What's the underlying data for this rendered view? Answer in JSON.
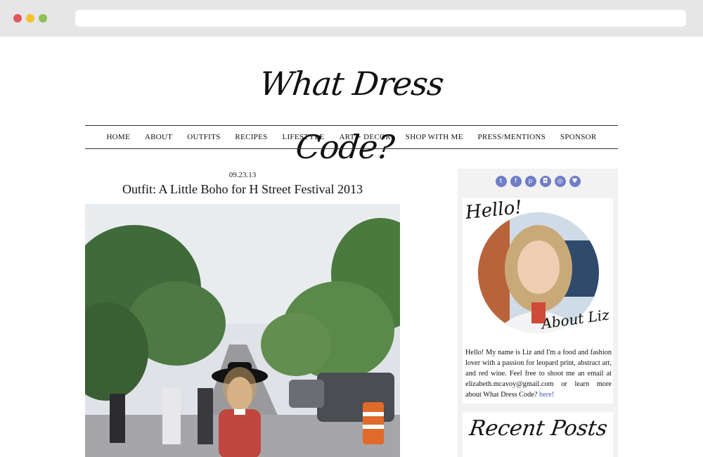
{
  "browser": {
    "url": ""
  },
  "site": {
    "logo": "What Dress Code?"
  },
  "nav": {
    "items": [
      "HOME",
      "ABOUT",
      "OUTFITS",
      "RECIPES",
      "LIFESTYLE",
      "ART + DECOR",
      "SHOP WITH ME",
      "PRESS/MENTIONS",
      "SPONSOR"
    ]
  },
  "post": {
    "date": "09.23.13",
    "title": "Outfit: A Little Boho for H Street Festival 2013"
  },
  "sidebar": {
    "social_icons": [
      "twitter-icon",
      "facebook-icon",
      "pinterest-icon",
      "instagram-icon",
      "rss-icon",
      "bloglovin-heart-icon"
    ],
    "hello": "Hello!",
    "about_heading": "About Liz",
    "bio_text": "Hello! My name is Liz and I'm a food and fashion lover with a passion for leopard print, abstract art, and red wine. Feel free to shoot me an email at elizabeth.mcavoy@gmail.com or learn more about What Dress Code?",
    "bio_link": "here!",
    "recent_posts_heading": "Recent Posts"
  },
  "colors": {
    "social_accent": "#6f7ec7",
    "link": "#3b5bb5",
    "sidebar_bg": "#f2f2f2"
  }
}
